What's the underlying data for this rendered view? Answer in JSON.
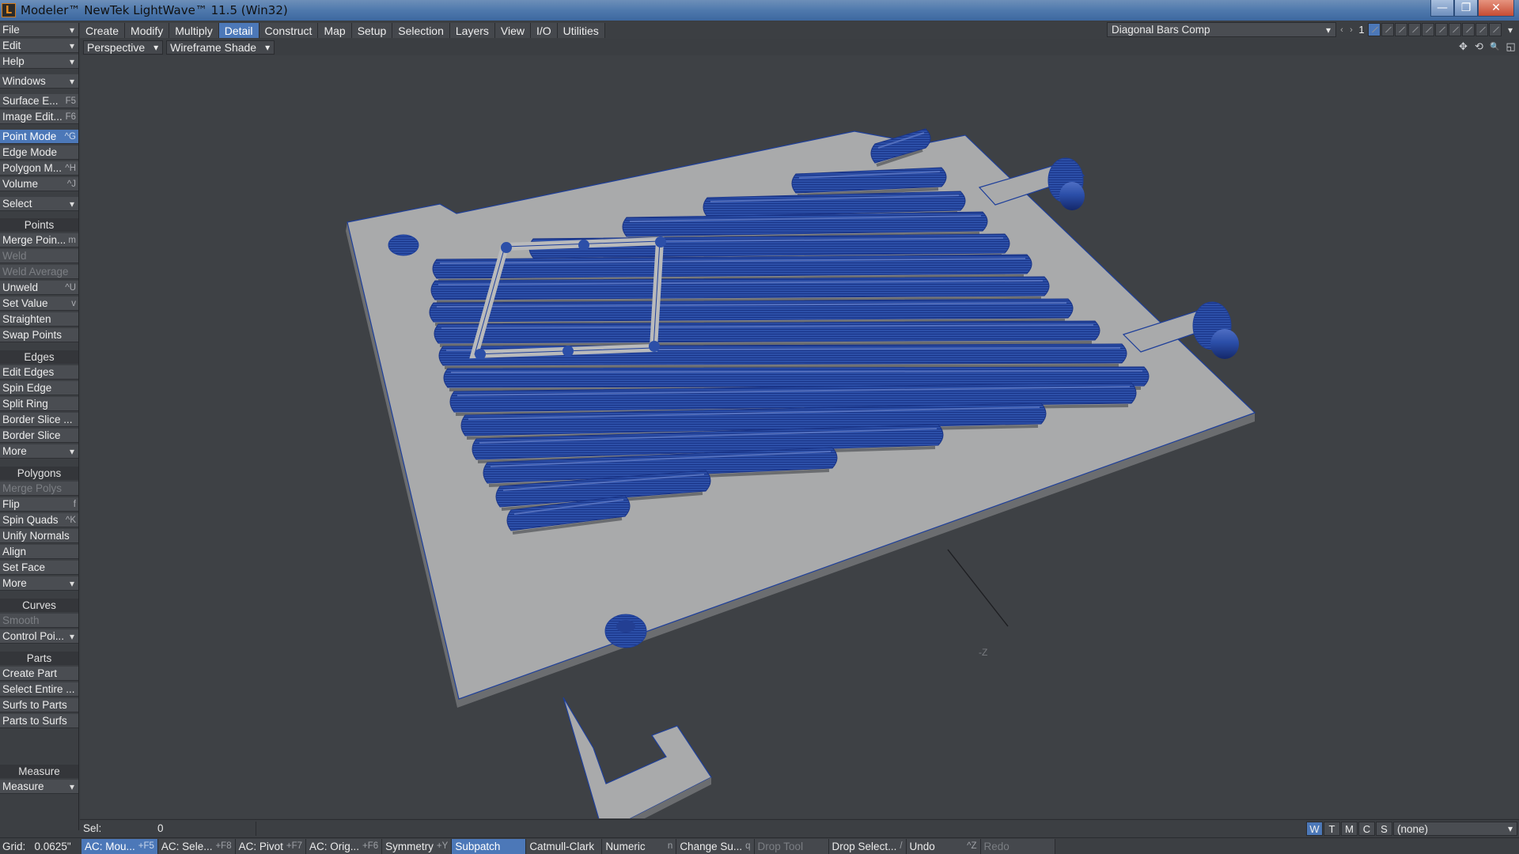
{
  "window": {
    "title": "Modeler™ NewTek LightWave™ 11.5 (Win32)",
    "icon_letter": "L",
    "minimize_glyph": "—",
    "maximize_glyph": "❐",
    "close_glyph": "✕"
  },
  "left_panel": {
    "file": "File",
    "edit": "Edit",
    "help": "Help",
    "windows": "Windows",
    "surface_editor": {
      "label": "Surface E...",
      "shortcut": "F5"
    },
    "image_editor": {
      "label": "Image Edit...",
      "shortcut": "F6"
    },
    "point_mode": {
      "label": "Point Mode",
      "shortcut": "^G"
    },
    "edge_mode": {
      "label": "Edge Mode"
    },
    "polygon_mode": {
      "label": "Polygon M...",
      "shortcut": "^H"
    },
    "volume": {
      "label": "Volume",
      "shortcut": "^J"
    },
    "select": "Select",
    "points_header": "Points",
    "merge_points": {
      "label": "Merge Poin...",
      "shortcut": "m"
    },
    "weld": "Weld",
    "weld_average": "Weld Average",
    "unweld": {
      "label": "Unweld",
      "shortcut": "^U"
    },
    "set_value": {
      "label": "Set Value",
      "shortcut": "v"
    },
    "straighten": "Straighten",
    "swap_points": "Swap Points",
    "edges_header": "Edges",
    "edit_edges": "Edit Edges",
    "spin_edge": "Spin Edge",
    "split_ring": "Split Ring",
    "border_slice_dots": "Border Slice ...",
    "border_slice": "Border Slice",
    "edges_more": "More",
    "polygons_header": "Polygons",
    "merge_polys": "Merge Polys",
    "flip": {
      "label": "Flip",
      "shortcut": "f"
    },
    "spin_quads": {
      "label": "Spin Quads",
      "shortcut": "^K"
    },
    "unify_normals": "Unify Normals",
    "align": "Align",
    "set_face": "Set Face",
    "polygons_more": "More",
    "curves_header": "Curves",
    "smooth": "Smooth",
    "control_points": "Control Poi...",
    "parts_header": "Parts",
    "create_part": "Create Part",
    "select_entire": "Select Entire ...",
    "surfs_to_parts": "Surfs to Parts",
    "parts_to_surfs": "Parts to Surfs",
    "measure_header": "Measure",
    "measure": "Measure"
  },
  "tabs": [
    "Create",
    "Modify",
    "Multiply",
    "Detail",
    "Construct",
    "Map",
    "Setup",
    "Selection",
    "Layers",
    "View",
    "I/O",
    "Utilities"
  ],
  "active_tab": "Detail",
  "layer_bar": {
    "object_name": "Diagonal Bars Comp",
    "prev_glyph": "‹",
    "next_glyph": "›",
    "layer_number": "1",
    "menu_glyph": "▾"
  },
  "viewport": {
    "view_type": "Perspective",
    "render_mode": "Wireframe Shade",
    "icons": [
      {
        "name": "move-view-icon",
        "glyph": "✥"
      },
      {
        "name": "rotate-view-icon",
        "glyph": "⟲"
      },
      {
        "name": "zoom-view-icon",
        "glyph": "🔍"
      },
      {
        "name": "maximize-view-icon",
        "glyph": "◱"
      }
    ],
    "axis_label": "-Z",
    "wire_color": "#1e3f9a",
    "surface_color": "#a9aaab",
    "background_color": "#3e4145"
  },
  "selection": {
    "label": "Sel:",
    "value": "0"
  },
  "view_toggles": [
    "W",
    "T",
    "M",
    "C",
    "S"
  ],
  "active_view_toggle": "W",
  "surface_select": "(none)",
  "status_bar": {
    "grid_label": "Grid:",
    "grid_value": "0.0625\"",
    "action_center_mouse": {
      "label": "AC: Mou...",
      "shortcut": "+F5"
    },
    "action_center_selection": {
      "label": "AC: Sele...",
      "shortcut": "+F8"
    },
    "action_center_pivot": {
      "label": "AC: Pivot",
      "shortcut": "+F7"
    },
    "action_center_origin": {
      "label": "AC: Orig...",
      "shortcut": "+F6"
    },
    "symmetry": {
      "label": "Symmetry",
      "shortcut": "+Y"
    },
    "subpatch": {
      "label": "Subpatch"
    },
    "catmull_clark": {
      "label": "Catmull-Clark"
    },
    "numeric": {
      "label": "Numeric",
      "shortcut": "n"
    },
    "change_surface": {
      "label": "Change Su...",
      "shortcut": "q"
    },
    "drop_tool": {
      "label": "Drop Tool"
    },
    "drop_selection": {
      "label": "Drop Select...",
      "shortcut": "/"
    },
    "undo": {
      "label": "Undo",
      "shortcut": "^Z"
    },
    "redo": {
      "label": "Redo"
    }
  }
}
